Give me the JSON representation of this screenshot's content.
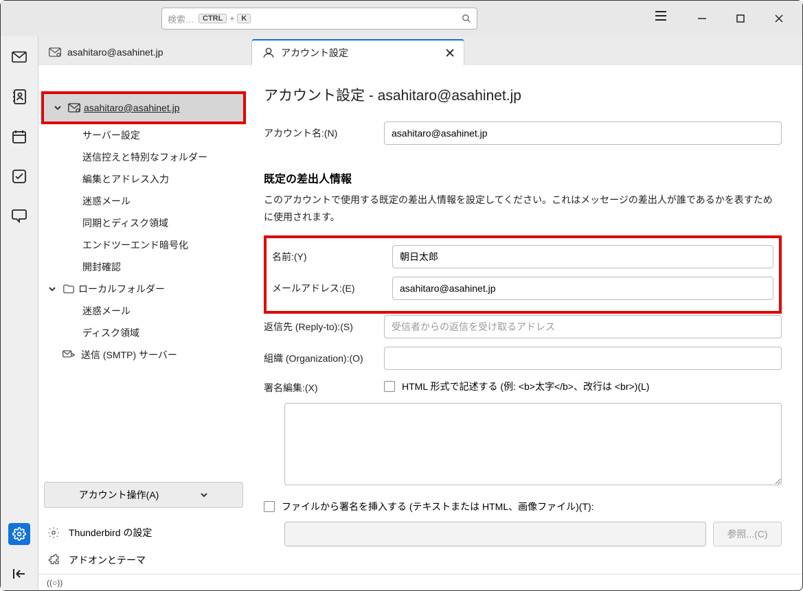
{
  "titlebar": {
    "search_placeholder": "検索…",
    "key1": "CTRL",
    "key2": "K"
  },
  "tabs": {
    "account_tab": "asahitaro@asahinet.jp",
    "settings_tab": "アカウント設定"
  },
  "sidebar": {
    "account": "asahitaro@asahinet.jp",
    "sub_server": "サーバー設定",
    "sub_copies": "送信控えと特別なフォルダー",
    "sub_compose": "編集とアドレス入力",
    "sub_junk": "迷惑メール",
    "sub_sync": "同期とディスク領域",
    "sub_e2e": "エンドツーエンド暗号化",
    "sub_receipt": "開封確認",
    "local_header": "ローカルフォルダー",
    "local_junk": "迷惑メール",
    "local_disk": "ディスク領域",
    "smtp": "送信 (SMTP) サーバー",
    "account_ops": "アカウント操作(A)",
    "tb_settings": "Thunderbird の設定",
    "addons": "アドオンとテーマ"
  },
  "main": {
    "heading": "アカウント設定 - asahitaro@asahinet.jp",
    "account_name_label": "アカウント名:(N)",
    "account_name_value": "asahitaro@asahinet.jp",
    "identity_heading": "既定の差出人情報",
    "identity_desc": "このアカウントで使用する既定の差出人情報を設定してください。これはメッセージの差出人が誰であるかを表すために使用されます。",
    "name_label": "名前:(Y)",
    "name_value": "朝日太郎",
    "email_label": "メールアドレス:(E)",
    "email_value": "asahitaro@asahinet.jp",
    "reply_label": "返信先 (Reply-to):(S)",
    "reply_placeholder": "受信者からの返信を受け取るアドレス",
    "org_label": "組織 (Organization):(O)",
    "sig_label": "署名編集:(X)",
    "sig_html": "HTML 形式で記述する (例: <b>太字</b>、改行は <br>)(L)",
    "file_sig": "ファイルから署名を挿入する (テキストまたは HTML、画像ファイル)(T):",
    "browse": "参照...(C)"
  },
  "status": {
    "sync": "((○))"
  }
}
